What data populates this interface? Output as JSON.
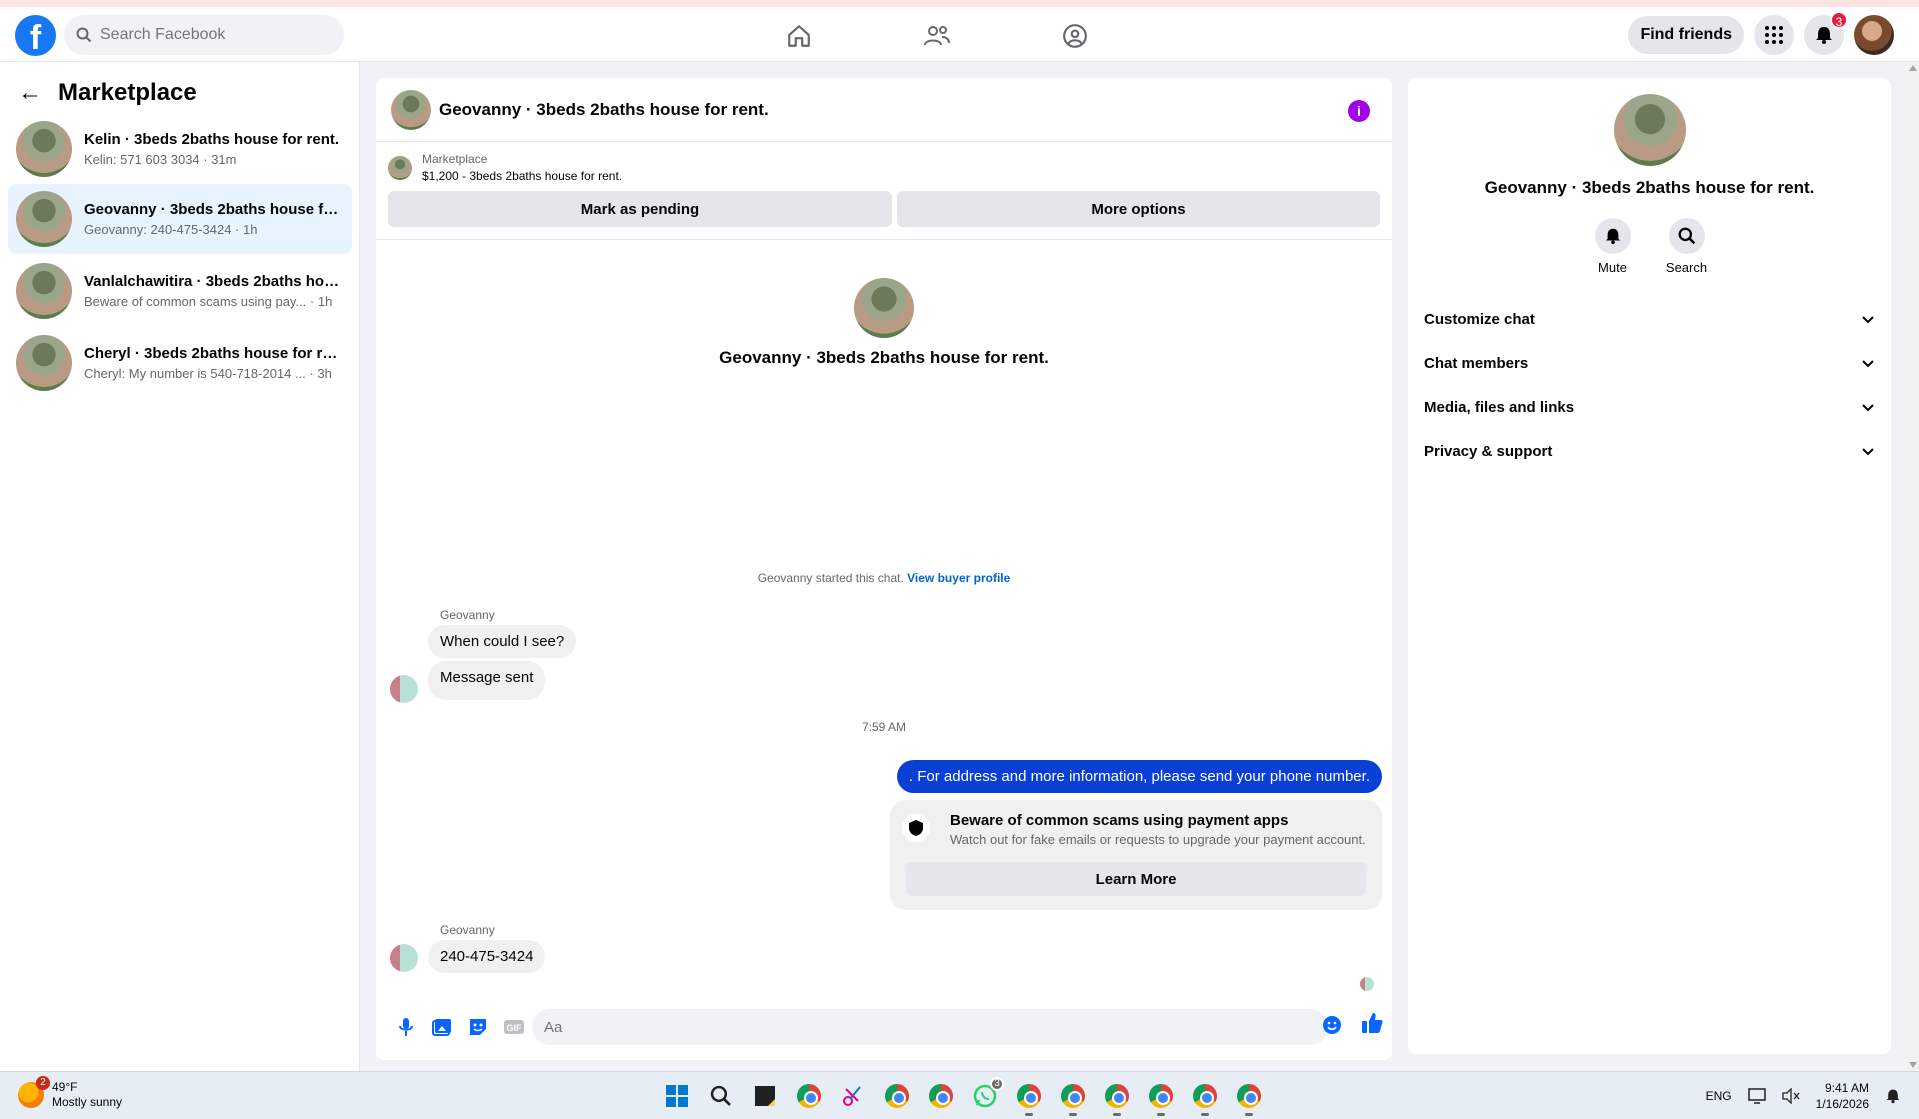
{
  "topbar": {
    "search_placeholder": "Search Facebook",
    "find_friends": "Find friends",
    "notif_count": "3"
  },
  "sidebar": {
    "title": "Marketplace",
    "conversations": [
      {
        "name": "Kelin · 3beds 2baths house for rent.",
        "preview": "Kelin: 571 603 3034 · 31m"
      },
      {
        "name": "Geovanny · 3beds 2baths house fo...",
        "preview": "Geovanny: 240-475-3424 · 1h"
      },
      {
        "name": "Vanlalchawitira · 3beds 2baths hou...",
        "preview": "Beware of common scams using pay... · 1h"
      },
      {
        "name": "Cheryl · 3beds 2baths house for re...",
        "preview": "Cheryl: My number is 540-718-2014 ... · 3h"
      }
    ]
  },
  "chat": {
    "title": "Geovanny · 3beds 2baths house for rent.",
    "marketplace_label": "Marketplace",
    "listing": "$1,200 - 3beds 2baths house for rent.",
    "mark_pending": "Mark as pending",
    "more_options": "More options",
    "intro_name": "Geovanny · 3beds 2baths house for rent.",
    "started_text": "Geovanny started this chat.",
    "view_buyer": "View buyer profile",
    "sender1": "Geovanny",
    "msg1": "When could I see?",
    "msg2": "Message sent",
    "timestamp": "7:59 AM",
    "msg_out": ". For address and more information, please send your phone number.",
    "warn_title": "Beware of common scams using payment apps",
    "warn_sub": "Watch out for fake emails or requests to upgrade your payment account.",
    "learn_more": "Learn More",
    "sender2": "Geovanny",
    "msg3": "240-475-3424",
    "composer_placeholder": "Aa"
  },
  "panel": {
    "name": "Geovanny · 3beds 2baths house for rent.",
    "mute": "Mute",
    "search": "Search",
    "sections": [
      "Customize chat",
      "Chat members",
      "Media, files and links",
      "Privacy & support"
    ]
  },
  "taskbar": {
    "temp": "49°F",
    "condition": "Mostly sunny",
    "weather_badge": "2",
    "whatsapp_badge": "3",
    "lang": "ENG",
    "time": "9:41 AM",
    "date": "1/16/2026"
  },
  "colors": {
    "brand": "#1877f2",
    "outgoing": "#0a3fd6",
    "active_conv": "#e7f3ff"
  }
}
